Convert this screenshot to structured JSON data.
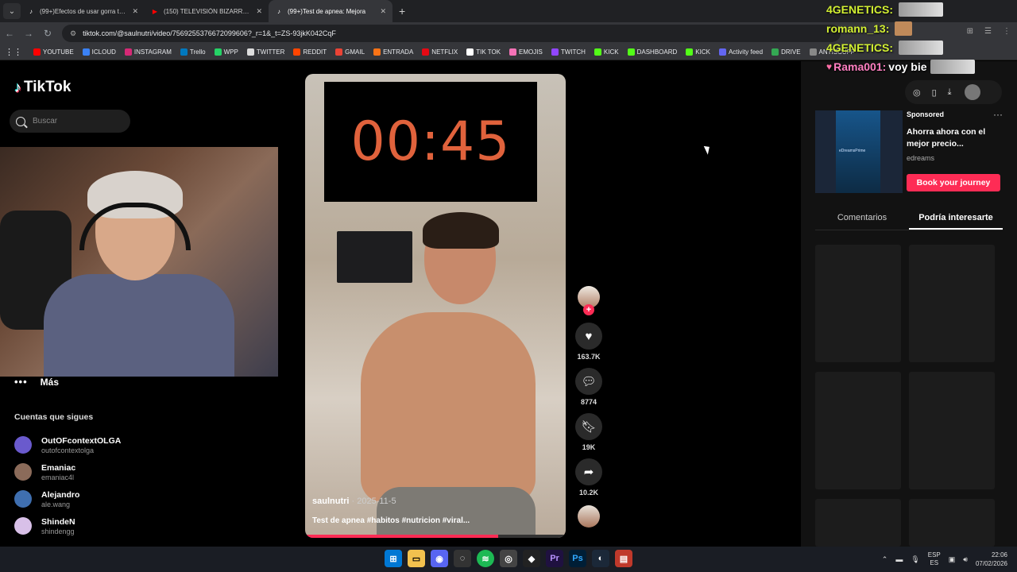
{
  "browser": {
    "tabs": [
      {
        "title": "(99+)Efectos de usar gorra todos",
        "active": false,
        "favicon": "tiktok-icon"
      },
      {
        "title": "(150) TELEVISIÓN BIZARRA - Yo",
        "active": false,
        "favicon": "youtube-icon"
      },
      {
        "title": "(99+)Test de apnea: Mejora",
        "active": true,
        "favicon": "tiktok-icon"
      }
    ],
    "url": "tiktok.com/@saulnutri/video/7569255376672099606?_r=1&_t=ZS-93jkK042CqF",
    "bookmarks": [
      {
        "label": "YOUTUBE",
        "color": "#ff0000"
      },
      {
        "label": "ICLOUD",
        "color": "#3b82f6"
      },
      {
        "label": "INSTAGRAM",
        "color": "#d62976"
      },
      {
        "label": "Trello",
        "color": "#0079bf"
      },
      {
        "label": "WPP",
        "color": "#25d366"
      },
      {
        "label": "TWITTER",
        "color": "#dddddd"
      },
      {
        "label": "REDDIT",
        "color": "#ff4500"
      },
      {
        "label": "GMAIL",
        "color": "#ea4335"
      },
      {
        "label": "ENTRADA",
        "color": "#f97316"
      },
      {
        "label": "NETFLIX",
        "color": "#e50914"
      },
      {
        "label": "TIK TOK",
        "color": "#ffffff"
      },
      {
        "label": "EMOJIS",
        "color": "#f472b6"
      },
      {
        "label": "TWITCH",
        "color": "#9146ff"
      },
      {
        "label": "KICK",
        "color": "#53fc18"
      },
      {
        "label": "DASHBOARD",
        "color": "#53fc18"
      },
      {
        "label": "KICK",
        "color": "#53fc18"
      },
      {
        "label": "Activity feed",
        "color": "#6366f1"
      },
      {
        "label": "DRIVE",
        "color": "#34a853"
      },
      {
        "label": "ANTISCUFF",
        "color": "#888888"
      }
    ]
  },
  "tiktok": {
    "logo_text": "TikTok",
    "search_placeholder": "Buscar",
    "more_label": "Más",
    "following_title": "Cuentas que sigues",
    "following": [
      {
        "name": "OutOFcontextOLGA",
        "handle": "outofcontextolga",
        "color": "#6a5acd"
      },
      {
        "name": "Emaniac",
        "handle": "emaniac4l",
        "color": "#8b6b5a"
      },
      {
        "name": "Alejandro",
        "handle": "ale.wang",
        "color": "#3f6fb0"
      },
      {
        "name": "ShindeN",
        "handle": "shindengg",
        "color": "#d8c0e8"
      }
    ],
    "video": {
      "timer": "00:45",
      "author": "saulnutri",
      "date": "2025-11-5",
      "description": "Test de apnea #habitos #nutricion #viral...",
      "progress": 0.74
    },
    "actions": {
      "likes": "163.7K",
      "comments": "8774",
      "saves": "19K",
      "shares": "10.2K"
    },
    "ad": {
      "sponsored": "Sponsored",
      "title": "Ahorra ahora con el mejor precio...",
      "brand": "edreams",
      "image_text": "eDreamsPrime",
      "cta": "Book your journey"
    },
    "side_tabs": {
      "comments": "Comentarios",
      "might_like": "Podría interesarte"
    }
  },
  "chat": [
    {
      "user": "4GENETICS:",
      "pink": false
    },
    {
      "user": "romann_13:",
      "pink": false
    },
    {
      "user": "4GENETICS:",
      "pink": false
    },
    {
      "user": "Rama001:",
      "text": "voy bie",
      "pink": true
    }
  ],
  "taskbar": {
    "lang_top": "ESP",
    "lang_bottom": "ES",
    "time": "22:06",
    "date": "07/02/2026"
  },
  "colors": {
    "accent": "#fe2c55",
    "timer": "#e0623c"
  }
}
